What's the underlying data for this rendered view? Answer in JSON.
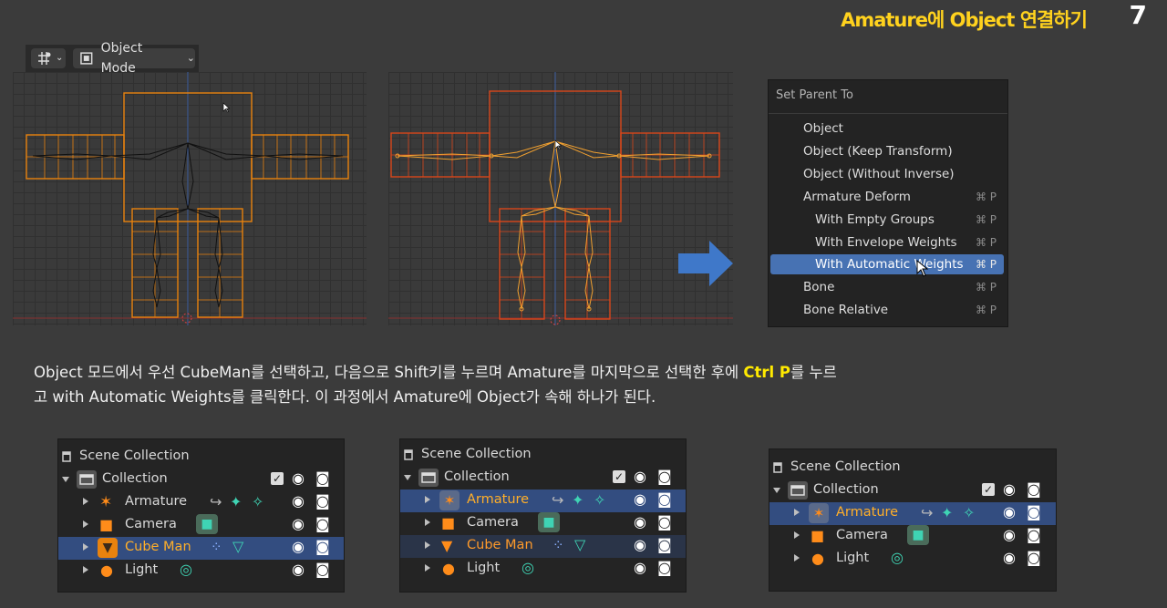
{
  "slide": {
    "title": "Amature에 Object 연결하기",
    "number": "7"
  },
  "header": {
    "mode_label": "Object Mode"
  },
  "menu": {
    "title": "Set Parent To",
    "items": [
      {
        "label": "Object",
        "shortcut": "",
        "indent": false,
        "selected": false
      },
      {
        "label": "Object (Keep Transform)",
        "shortcut": "",
        "indent": false,
        "selected": false
      },
      {
        "label": "Object (Without Inverse)",
        "shortcut": "",
        "indent": false,
        "selected": false
      },
      {
        "label": "Armature Deform",
        "shortcut": "⌘ P",
        "indent": false,
        "selected": false
      },
      {
        "label": "With Empty Groups",
        "shortcut": "⌘ P",
        "indent": true,
        "selected": false
      },
      {
        "label": "With Envelope Weights",
        "shortcut": "⌘ P",
        "indent": true,
        "selected": false
      },
      {
        "label": "With Automatic Weights",
        "shortcut": "⌘ P",
        "indent": true,
        "selected": true
      },
      {
        "label": "Bone",
        "shortcut": "⌘ P",
        "indent": false,
        "selected": false
      },
      {
        "label": "Bone Relative",
        "shortcut": "⌘ P",
        "indent": false,
        "selected": false
      }
    ]
  },
  "description": {
    "line1_a": "Object 모드에서 우선 CubeMan를 선택하고, 다음으로 Shift키를 누르며 Amature를 마지막으로 선택한 후에 ",
    "line1_hl": "Ctrl P",
    "line1_b": "를 누르",
    "line2": "고 with Automatic Weights를 클릭한다.  이 과정에서 Amature에 Object가 속해 하나가 된다."
  },
  "outliner": {
    "scene_label": "Scene Collection",
    "collection_label": "Collection",
    "armature_label": "Armature",
    "camera_label": "Camera",
    "cubeman_label": "Cube Man",
    "light_label": "Light"
  },
  "colors": {
    "accent": "#4772b3",
    "highlight": "#ffea00",
    "title": "#ffd21e",
    "mesh_orange": "#e07a10",
    "selected_text": "#ffaf29"
  }
}
